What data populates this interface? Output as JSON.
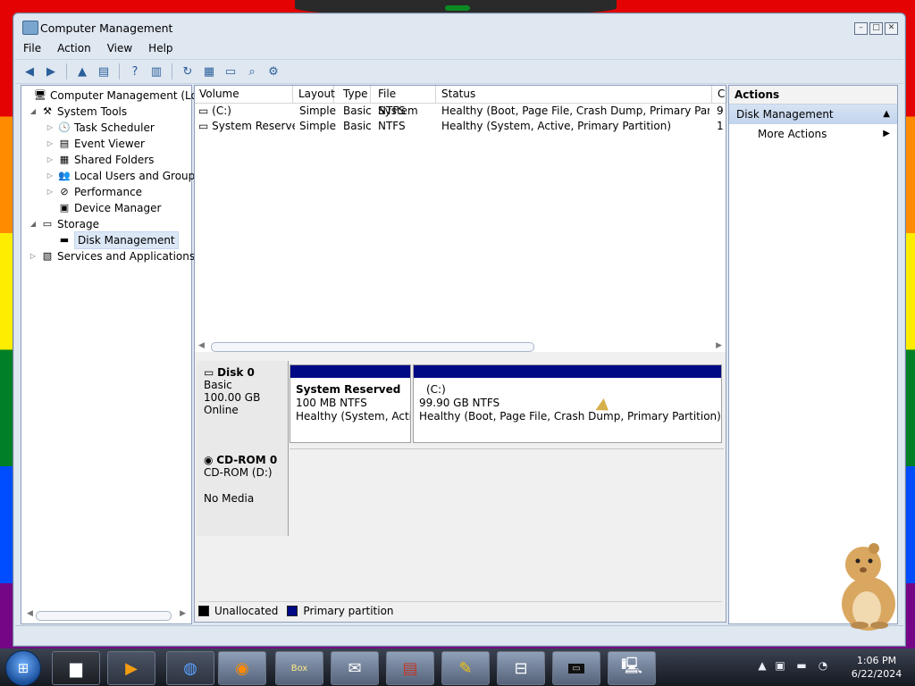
{
  "window": {
    "title": "Computer Management",
    "controls": [
      "–",
      "□",
      "✕"
    ]
  },
  "menu": [
    "File",
    "Action",
    "View",
    "Help"
  ],
  "tree": {
    "root": "Computer Management (Local",
    "system_tools": "System Tools",
    "task_scheduler": "Task Scheduler",
    "event_viewer": "Event Viewer",
    "shared_folders": "Shared Folders",
    "local_users": "Local Users and Groups",
    "performance": "Performance",
    "device_manager": "Device Manager",
    "storage": "Storage",
    "disk_management": "Disk Management",
    "services": "Services and Applications"
  },
  "volumes": {
    "headers": [
      "Volume",
      "Layout",
      "Type",
      "File System",
      "Status",
      "C"
    ],
    "rows": [
      {
        "volume": "(C:)",
        "layout": "Simple",
        "type": "Basic",
        "fs": "NTFS",
        "status": "Healthy (Boot, Page File, Crash Dump, Primary Partition)",
        "cap": "9"
      },
      {
        "volume": "System Reserved",
        "layout": "Simple",
        "type": "Basic",
        "fs": "NTFS",
        "status": "Healthy (System, Active, Primary Partition)",
        "cap": "1"
      }
    ]
  },
  "disks": {
    "disk0": {
      "name": "Disk 0",
      "type": "Basic",
      "size": "100.00 GB",
      "state": "Online",
      "partitions": [
        {
          "title": "System Reserved",
          "size": "100 MB NTFS",
          "status": "Healthy (System, Active"
        },
        {
          "title": "(C:)",
          "size": "99.90 GB NTFS",
          "status": "Healthy (Boot, Page File, Crash Dump, Primary Partition)"
        }
      ]
    },
    "cdrom0": {
      "name": "CD-ROM 0",
      "drive": "CD-ROM (D:)",
      "state": "No Media"
    }
  },
  "legend": {
    "unallocated": "Unallocated",
    "primary": "Primary partition",
    "colors": {
      "unallocated": "#000000",
      "primary": "#000a85"
    }
  },
  "actions": {
    "header": "Actions",
    "section": "Disk Management",
    "more": "More Actions"
  },
  "taskbar": {
    "time": "1:06 PM",
    "date": "6/22/2024",
    "icons": [
      "window-icon",
      "media-player-icon",
      "globe-icon",
      "firefox-icon",
      "box-game-icon",
      "mail-icon",
      "archive-icon",
      "paint-icon",
      "network-icon",
      "terminal-icon",
      "computer-icon"
    ],
    "box_label": "Box"
  }
}
